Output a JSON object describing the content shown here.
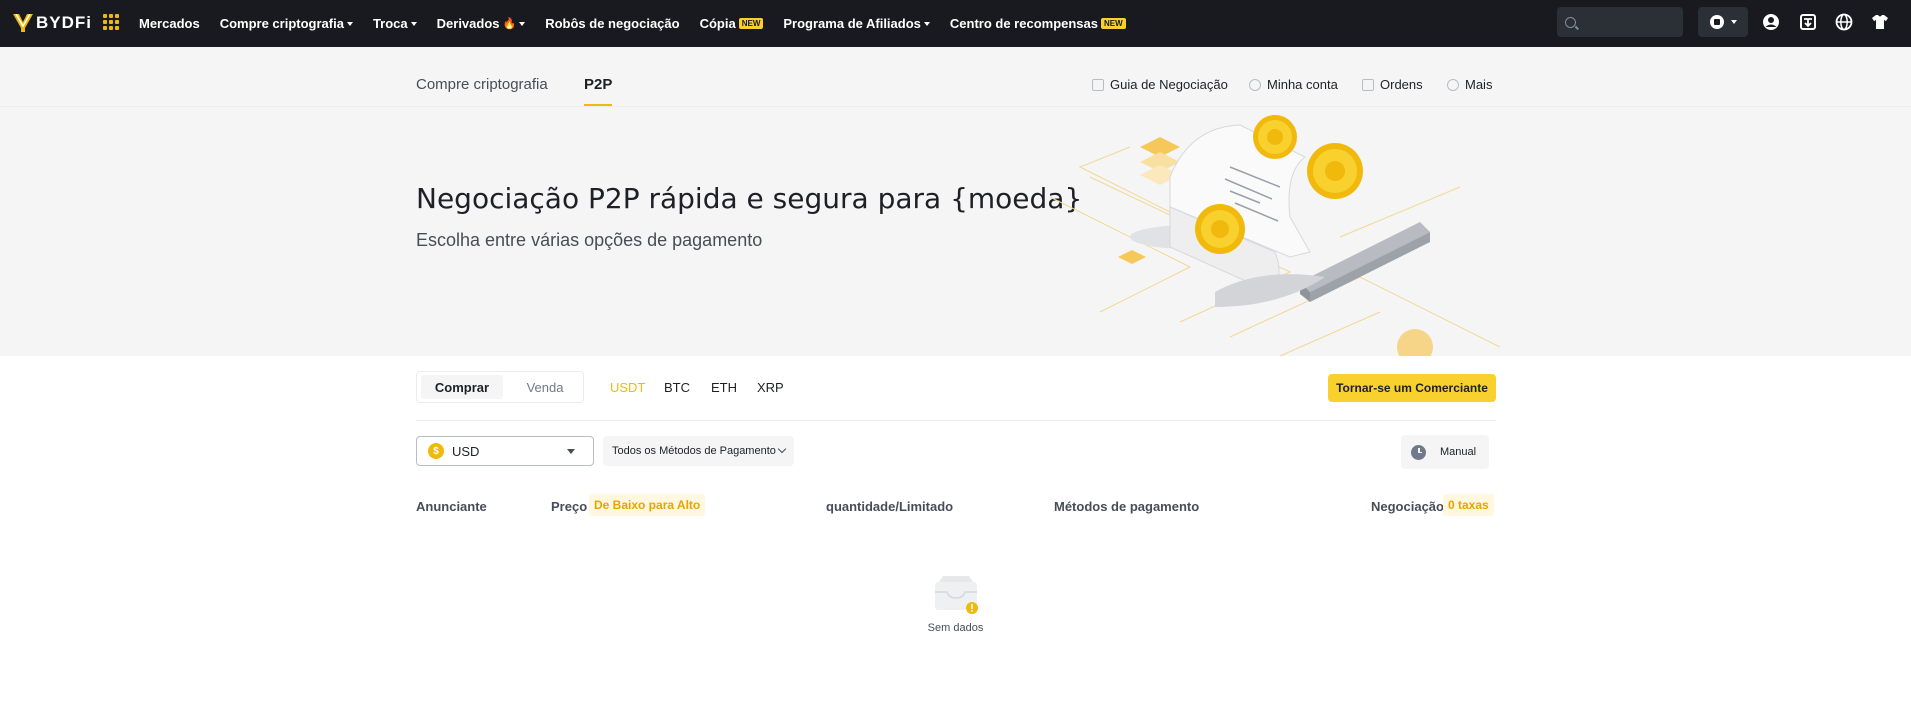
{
  "topnav": {
    "logo_text": "BYDFi",
    "links": [
      {
        "label": "Mercados",
        "caret": false
      },
      {
        "label": "Compre criptografia",
        "caret": true
      },
      {
        "label": "Troca",
        "caret": true
      },
      {
        "label": "Derivados",
        "caret": true,
        "fire": true
      },
      {
        "label": "Robôs de negociação",
        "caret": false
      },
      {
        "label": "Cópia",
        "badge": "NEW"
      },
      {
        "label": "Programa de Afiliados",
        "caret": true
      },
      {
        "label": "Centro de recompensas",
        "badge": "NEW"
      }
    ],
    "fire_glyph": "🔥",
    "search_placeholder": ""
  },
  "subnav": {
    "tab_buy_crypto": "Compre criptografia",
    "tab_p2p": "P2P",
    "link_guide": "Guia de Negociação",
    "link_account": "Minha conta",
    "link_orders": "Ordens",
    "link_more": "Mais"
  },
  "hero": {
    "title": "Negociação P2P rápida e segura para {moeda}",
    "subtitle": "Escolha entre várias opções de pagamento"
  },
  "filters": {
    "buy_label": "Comprar",
    "sell_label": "Venda",
    "coins": [
      "USDT",
      "BTC",
      "ETH",
      "XRP"
    ],
    "active_coin": "USDT",
    "merchant_button": "Tornar-se um Comerciante",
    "currency": "USD",
    "currency_symbol": "$",
    "payment_methods": "Todos os Métodos de Pagamento",
    "manual_label": "Manual"
  },
  "table": {
    "col_advertiser": "Anunciante",
    "col_price": "Preço",
    "price_sort": "De Baixo para Alto",
    "col_quantity": "quantidade/Limitado",
    "col_payment": "Métodos de pagamento",
    "col_trade": "Negociação",
    "fee_tag": "0 taxas",
    "empty_text": "Sem dados"
  },
  "colors": {
    "accent": "#f0b90b",
    "nav_bg": "#181a20",
    "badge": "#f8d12f"
  }
}
